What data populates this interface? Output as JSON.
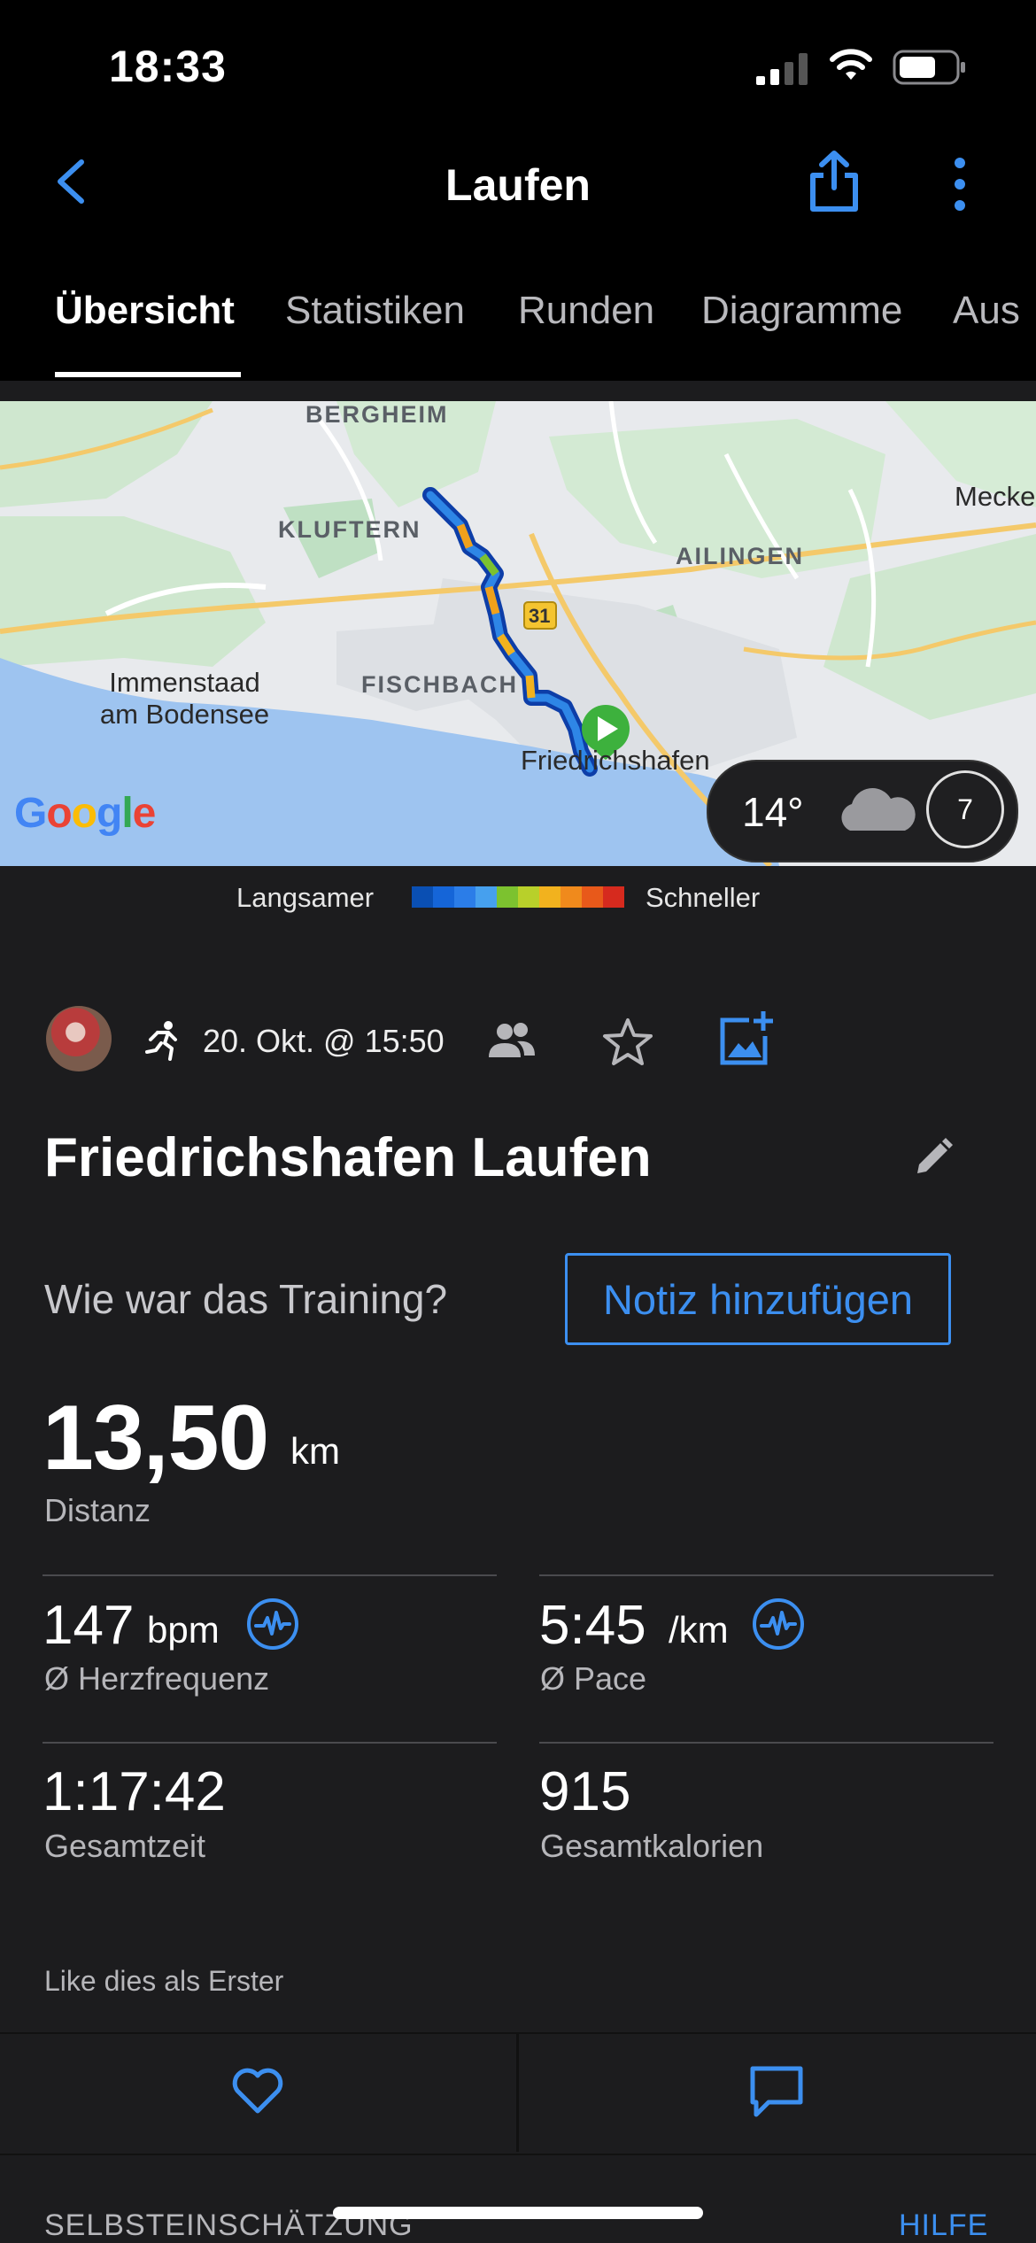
{
  "status_bar": {
    "time": "18:33"
  },
  "nav": {
    "title": "Laufen"
  },
  "tabs": [
    "Übersicht",
    "Statistiken",
    "Runden",
    "Diagramme",
    "Aus"
  ],
  "map": {
    "labels": {
      "bergheim": "BERGHEIM",
      "kluftern": "KLUFTERN",
      "ailingen": "AILINGEN",
      "fischbach": "FISCHBACH",
      "meckenbeuren": "Mecke",
      "immenstaad": "Immenstaad\nam Bodensee",
      "friedrichshafen": "Friedrichshafen",
      "road": "31"
    },
    "google": "Google",
    "weather": {
      "temperature": "14°",
      "wind": "7"
    }
  },
  "legend": {
    "slower": "Langsamer",
    "faster": "Schneller",
    "colors": [
      "#0a4fb3",
      "#1565d8",
      "#2b7de8",
      "#46a0ee",
      "#7cc22f",
      "#b8d02a",
      "#f2b21e",
      "#f08a1c",
      "#e8591a",
      "#d62a1e"
    ]
  },
  "activity": {
    "date": "20. Okt. @ 15:50",
    "title": "Friedrichshafen Laufen",
    "prompt": "Wie war das Training?",
    "note_button": "Notiz hinzufügen",
    "distance": {
      "value": "13,50",
      "unit": "km",
      "label": "Distanz"
    },
    "heart_rate": {
      "value": "147",
      "unit": "bpm",
      "label": "Ø Herzfrequenz"
    },
    "pace": {
      "value": "5:45",
      "unit": "/km",
      "label": "Ø Pace"
    },
    "total_time": {
      "value": "1:17:42",
      "label": "Gesamtzeit"
    },
    "calories": {
      "value": "915",
      "label": "Gesamtkalorien"
    },
    "like_first": "Like dies als Erster"
  },
  "footer": {
    "self_assessment": "SELBSTEINSCHÄTZUNG",
    "help": "HILFE"
  },
  "colors": {
    "accent": "#3c8ff0",
    "background": "#1c1c1e"
  }
}
